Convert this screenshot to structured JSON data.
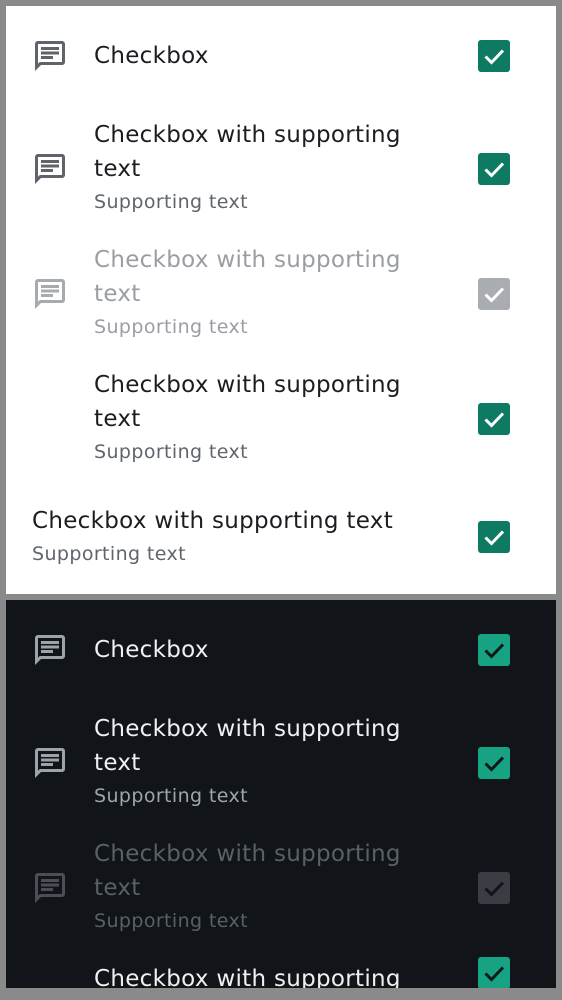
{
  "light_list": {
    "items": [
      {
        "title": "Checkbox",
        "checked": true,
        "state": "enabled",
        "icon": "message-icon"
      },
      {
        "title": "Checkbox with supporting text",
        "supporting": "Supporting text",
        "checked": true,
        "state": "enabled",
        "icon": "message-icon"
      },
      {
        "title": "Checkbox with supporting text",
        "supporting": "Supporting text",
        "checked": true,
        "state": "disabled",
        "icon": "message-icon"
      },
      {
        "title": "Checkbox with supporting text",
        "supporting": "Supporting text",
        "checked": true,
        "state": "enabled",
        "icon": null
      },
      {
        "title": "Checkbox with supporting text",
        "supporting": "Supporting text",
        "checked": true,
        "state": "enabled",
        "icon": null
      }
    ]
  },
  "dark_list": {
    "items": [
      {
        "title": "Checkbox",
        "checked": true,
        "state": "enabled",
        "icon": "message-icon"
      },
      {
        "title": "Checkbox with supporting text",
        "supporting": "Supporting text",
        "checked": true,
        "state": "enabled",
        "icon": "message-icon"
      },
      {
        "title": "Checkbox with supporting text",
        "supporting": "Supporting text",
        "checked": true,
        "state": "disabled",
        "icon": "message-icon"
      },
      {
        "title": "Checkbox with supporting",
        "checked": true,
        "state": "enabled",
        "icon": null
      }
    ]
  },
  "colors": {
    "accent_light": "#0e7a62",
    "accent_dark": "#16a283",
    "surface_light": "#ffffff",
    "surface_dark": "#111418"
  }
}
